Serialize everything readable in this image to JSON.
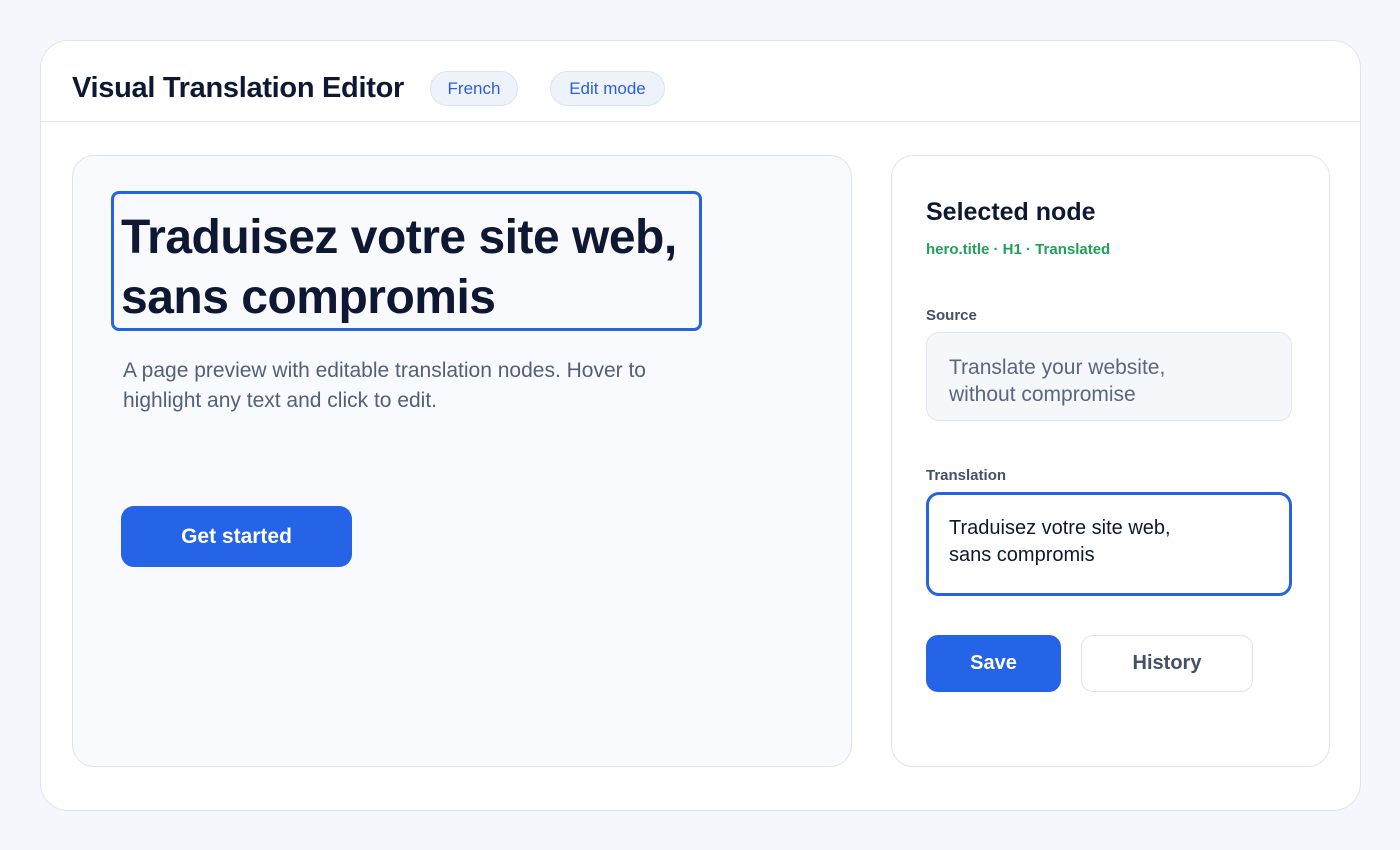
{
  "header": {
    "title": "Visual Translation Editor",
    "language_pill": "French",
    "mode_pill": "Edit mode"
  },
  "preview": {
    "hero_title": "Traduisez votre site web,\nsans compromis",
    "hero_subtitle": "A page preview with editable translation nodes. Hover to highlight any text and click to edit.",
    "cta_label": "Get started"
  },
  "inspector": {
    "title": "Selected node",
    "meta": "hero.title · H1 · Translated",
    "source_label": "Source",
    "source_text": "Translate your website,\nwithout compromise",
    "translation_label": "Translation",
    "translation_text": "Traduisez votre site web,\nsans compromis",
    "save_label": "Save",
    "history_label": "History"
  },
  "colors": {
    "accent": "#2563e7",
    "status_translated": "#22a05a",
    "pill_text": "#2b5fd9"
  }
}
